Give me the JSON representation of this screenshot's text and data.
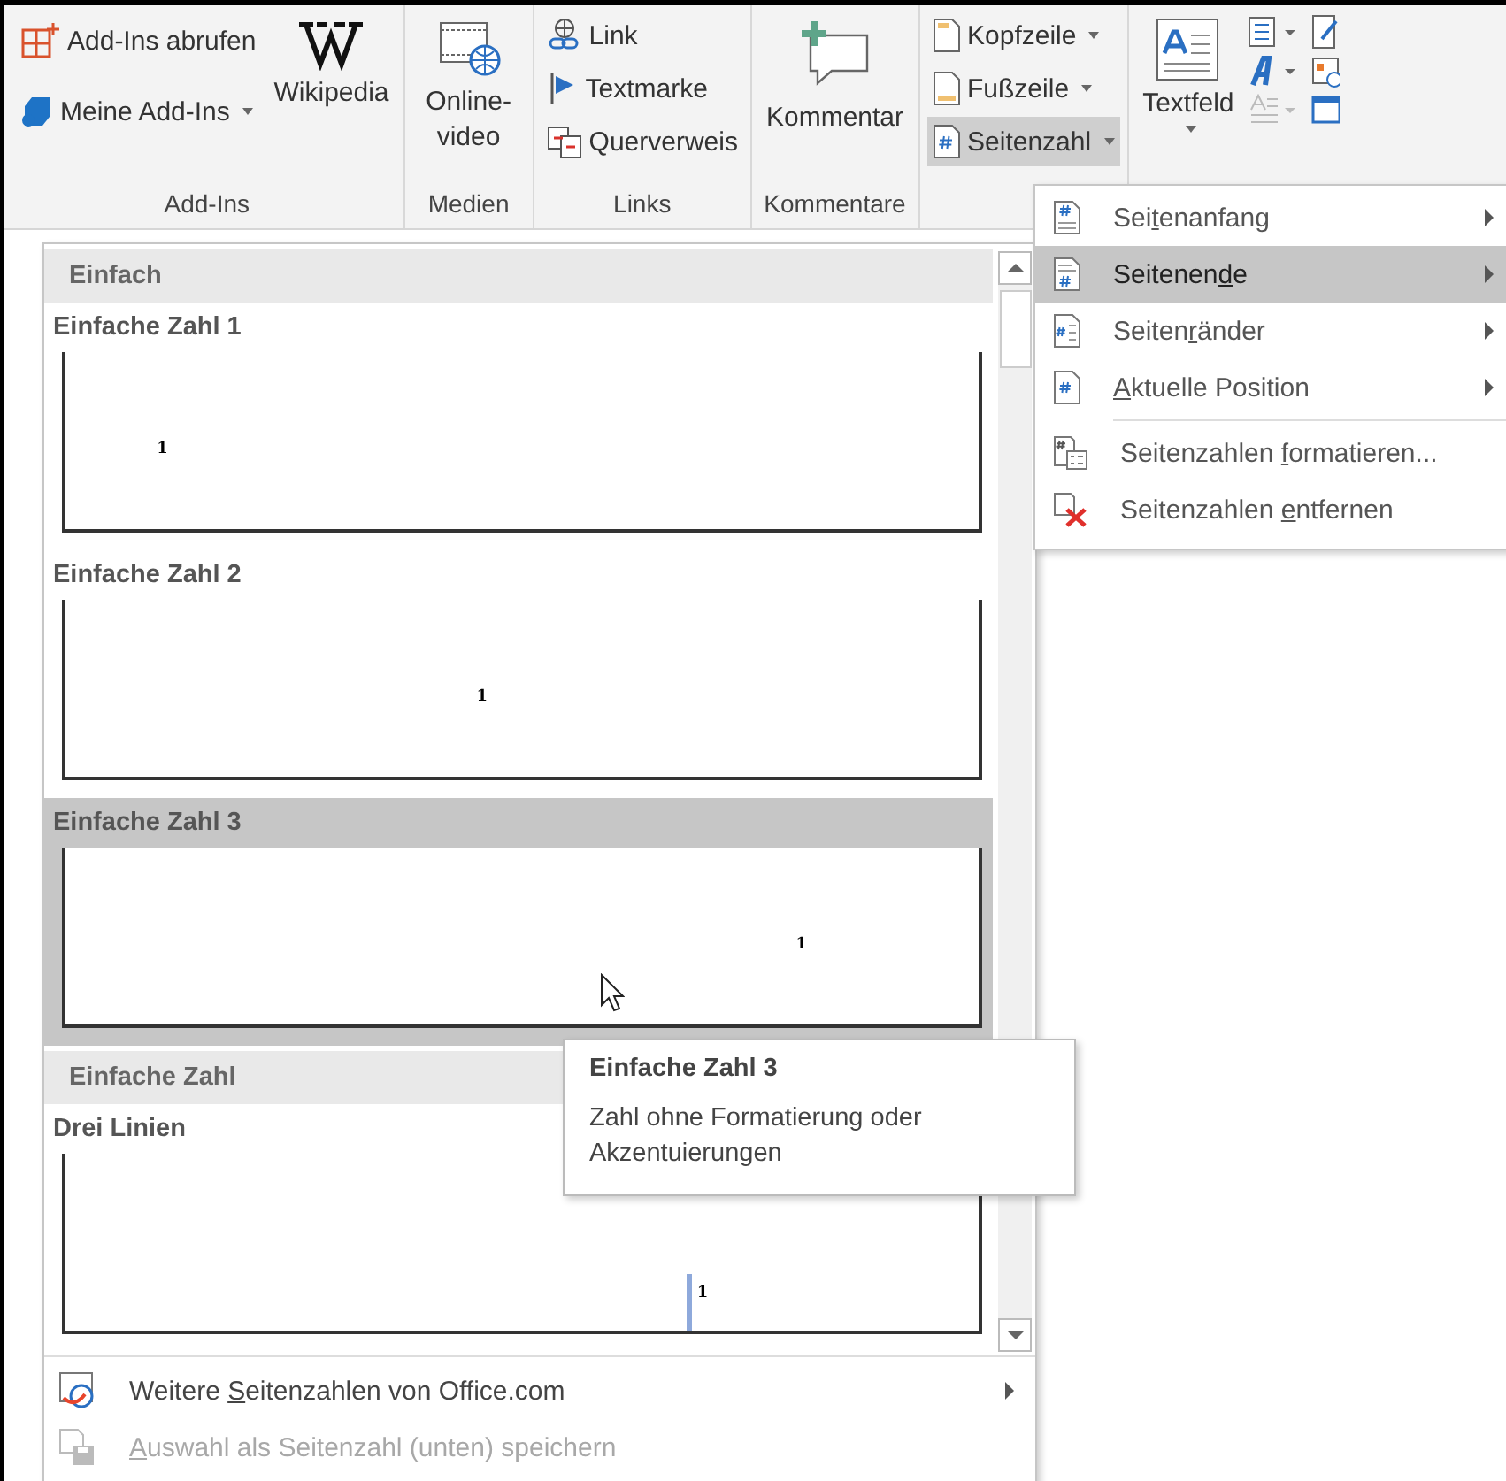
{
  "ribbon": {
    "groups": [
      {
        "label": "Add-Ins",
        "kind": "addins",
        "buttons": [
          {
            "label": "Add-Ins abrufen"
          },
          {
            "label": "Meine Add-Ins",
            "dropdown": true
          },
          {
            "label": "Wikipedia"
          }
        ]
      },
      {
        "label": "Medien",
        "kind": "media",
        "buttons": [
          {
            "label": "Online-video"
          }
        ]
      },
      {
        "label": "Links",
        "kind": "links",
        "buttons": [
          {
            "label": "Link"
          },
          {
            "label": "Textmarke"
          },
          {
            "label": "Querverweis"
          }
        ]
      },
      {
        "label": "Kommentare",
        "kind": "comments",
        "buttons": [
          {
            "label": "Kommentar"
          }
        ]
      },
      {
        "kind": "header",
        "buttons": [
          {
            "label": "Kopfzeile",
            "dropdown": true,
            "selected": false
          },
          {
            "label": "Fußzeile",
            "dropdown": true,
            "selected": false
          },
          {
            "label": "Seitenzahl",
            "dropdown": true,
            "selected": true
          }
        ]
      },
      {
        "kind": "text",
        "buttons": [
          {
            "label": "Textfeld",
            "dropdown": true
          }
        ]
      }
    ]
  },
  "gallery": {
    "sections": [
      {
        "title": "Einfach",
        "items": [
          {
            "title": "Einfache Zahl 1",
            "kind": "left",
            "number": "1",
            "selected": false
          },
          {
            "title": "Einfache Zahl 2",
            "kind": "center",
            "number": "1",
            "selected": false
          },
          {
            "title": "Einfache Zahl 3",
            "kind": "right",
            "number": "1",
            "selected": true
          }
        ]
      },
      {
        "title": "Einfache Zahl",
        "items": [
          {
            "title": "Drei Linien",
            "kind": "lines",
            "number": "1",
            "selected": false
          }
        ]
      }
    ],
    "footer": [
      {
        "before": "Weitere ",
        "key": "S",
        "after": "eitenzahlen von Office.com",
        "kind": "web",
        "submenu": true,
        "disabled": false
      },
      {
        "key": "A",
        "after": "uswahl als Seitenzahl (unten) speichern",
        "kind": "save",
        "submenu": false,
        "disabled": true
      }
    ]
  },
  "submenu": {
    "items": [
      {
        "before": "Sei",
        "key": "t",
        "after": "enanfang",
        "kind": "top",
        "submenu": true,
        "selected": false
      },
      {
        "before": "Seitenen",
        "key": "d",
        "after": "e",
        "kind": "bottom",
        "submenu": true,
        "selected": true
      },
      {
        "before": "Seiten",
        "key": "r",
        "after": "änder",
        "kind": "margin",
        "submenu": true,
        "selected": false
      },
      {
        "key": "A",
        "after": "ktuelle Position",
        "kind": "current",
        "submenu": true,
        "selected": false
      }
    ],
    "actions": [
      {
        "before": "Seitenzahlen ",
        "key": "f",
        "after": "ormatieren...",
        "kind": "format"
      },
      {
        "before": "Seitenzahlen ",
        "key": "e",
        "after": "ntfernen",
        "kind": "remove"
      }
    ]
  },
  "tooltip": {
    "title": "Einfache Zahl 3",
    "text": "Zahl ohne Formatierung oder Akzentuierungen"
  }
}
